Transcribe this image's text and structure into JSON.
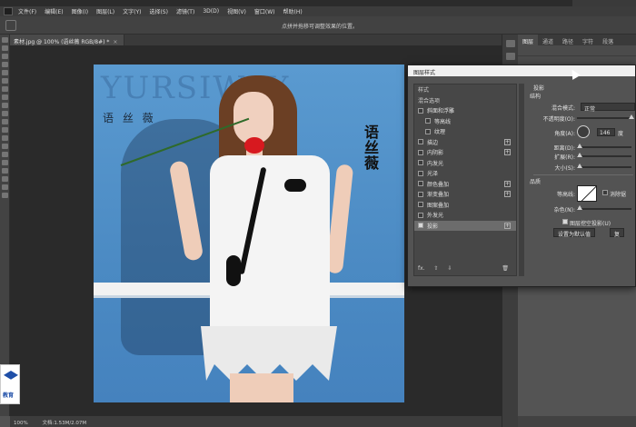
{
  "menubar": {
    "items": [
      "文件(F)",
      "编辑(E)",
      "图像(I)",
      "图层(L)",
      "文字(Y)",
      "选择(S)",
      "滤镜(T)",
      "3D(D)",
      "视图(V)",
      "窗口(W)",
      "帮助(H)"
    ]
  },
  "optionsbar": {
    "hint": "点拼并拖移可调整效果的位置。"
  },
  "document": {
    "tab_label": "素材.jpg @ 100% (语丝薇 RGB/8#) *",
    "close_glyph": "×"
  },
  "photo": {
    "bg_text": "YURSIWAY",
    "left_brand": "语 丝 薇",
    "calligraphy": "语丝薇",
    "watermark_text": "教育"
  },
  "status": {
    "zoom": "100%",
    "doc_info": "文档:1.53M/2.07M"
  },
  "layers_panel": {
    "tabs": [
      "图层",
      "通道",
      "路径",
      "字符",
      "段落"
    ]
  },
  "dialog": {
    "title": "图层样式",
    "styles": [
      {
        "label": "样式",
        "checkbox": false,
        "plus": false,
        "header": true
      },
      {
        "label": "混合选项",
        "checkbox": false,
        "plus": false,
        "header": true
      },
      {
        "label": "斜面和浮雕",
        "checkbox": true,
        "checked": false,
        "plus": false
      },
      {
        "label": "等高线",
        "checkbox": true,
        "checked": false,
        "plus": false,
        "indent": true
      },
      {
        "label": "纹理",
        "checkbox": true,
        "checked": false,
        "plus": false,
        "indent": true
      },
      {
        "label": "描边",
        "checkbox": true,
        "checked": false,
        "plus": true
      },
      {
        "label": "内阴影",
        "checkbox": true,
        "checked": false,
        "plus": true
      },
      {
        "label": "内发光",
        "checkbox": true,
        "checked": false,
        "plus": false
      },
      {
        "label": "光泽",
        "checkbox": true,
        "checked": false,
        "plus": false
      },
      {
        "label": "颜色叠加",
        "checkbox": true,
        "checked": false,
        "plus": true
      },
      {
        "label": "渐变叠加",
        "checkbox": true,
        "checked": false,
        "plus": true
      },
      {
        "label": "图案叠加",
        "checkbox": true,
        "checked": false,
        "plus": false
      },
      {
        "label": "外发光",
        "checkbox": true,
        "checked": false,
        "plus": false
      },
      {
        "label": "投影",
        "checkbox": true,
        "checked": true,
        "plus": true,
        "active": true
      }
    ],
    "footer_fx": "fx.",
    "footer_up": "⇧",
    "footer_down": "⇩",
    "footer_trash": "🗑",
    "settings": {
      "section_title": "投影",
      "structure": "结构",
      "blend_mode_label": "混合模式:",
      "blend_mode_value": "正常",
      "opacity_label": "不透明度(O):",
      "opacity_value": 100,
      "angle_label": "角度(A):",
      "angle_value": "146",
      "angle_unit": "度",
      "distance_label": "距离(D):",
      "distance_value": 0,
      "spread_label": "扩展(R):",
      "spread_value": 0,
      "size_label": "大小(S):",
      "size_value": 0,
      "quality": "品质",
      "contour_label": "等高线:",
      "antialias_label": "消除锯",
      "noise_label": "杂色(N):",
      "noise_value": 0,
      "knockout_label": "图层挖空投影(U)",
      "default_button": "设置为默认值",
      "reset_button": "复"
    }
  },
  "colors": {
    "app_bg": "#535353",
    "dialog_bg": "#535353",
    "accent_blue": "#4f8fc7"
  }
}
